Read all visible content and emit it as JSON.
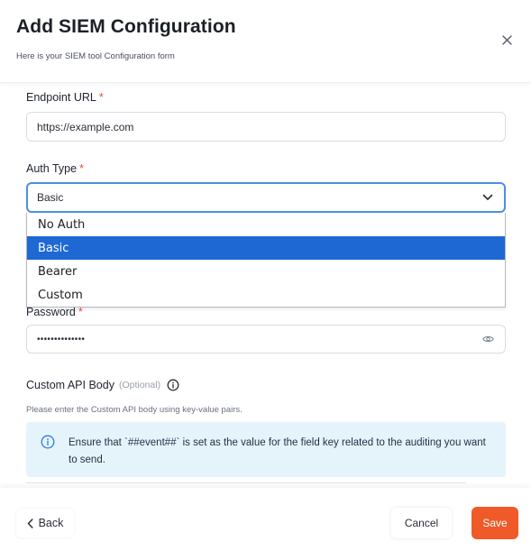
{
  "header": {
    "title": "Add SIEM Configuration",
    "subtitle": "Here is your SIEM tool Configuration form",
    "close_icon": "close-icon"
  },
  "form": {
    "endpoint": {
      "label": "Endpoint URL",
      "required_mark": "*",
      "value": "https://example.com"
    },
    "auth_type": {
      "label": "Auth Type",
      "required_mark": "*",
      "value": "Basic",
      "options": [
        "No Auth",
        "Basic",
        "Bearer",
        "Custom"
      ],
      "selected_index": 1
    },
    "password": {
      "label": "Password",
      "required_mark": "*",
      "value": "••••••••••••••",
      "icon": "eye-icon"
    },
    "custom_api_body": {
      "label": "Custom API Body",
      "optional": "(Optional)",
      "help": "Please enter the Custom API body using key-value pairs.",
      "notice": "Ensure that `##event##` is set as the value for the field key related to the auditing you want to send."
    }
  },
  "footer": {
    "back_label": "Back",
    "cancel_label": "Cancel",
    "save_label": "Save"
  },
  "colors": {
    "accent": "#f05a28",
    "focus": "#4a90e2",
    "selected_option": "#1e68d4",
    "notice_bg": "#e5f4fb",
    "required": "#e0503a"
  }
}
